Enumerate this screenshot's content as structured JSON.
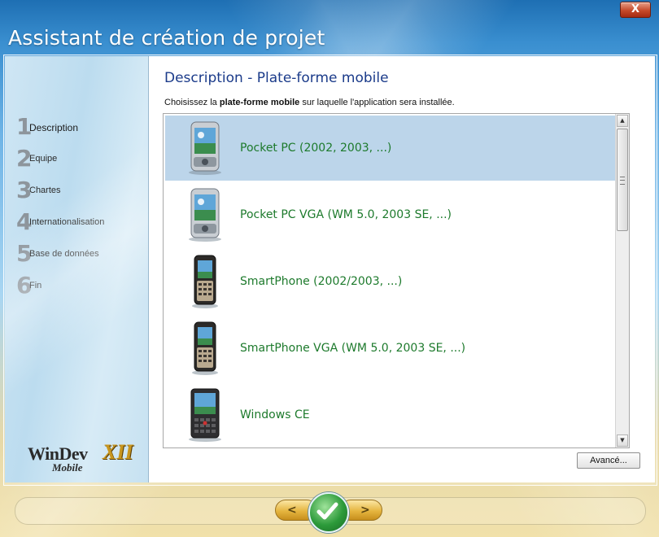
{
  "window": {
    "title": "Assistant de création de projet",
    "close_label": "X"
  },
  "sidebar": {
    "steps": [
      {
        "num": "1",
        "label": "Description",
        "active": true
      },
      {
        "num": "2",
        "label": "Equipe"
      },
      {
        "num": "3",
        "label": "Chartes"
      },
      {
        "num": "4",
        "label": "Internationalisation"
      },
      {
        "num": "5",
        "label": "Base de données"
      },
      {
        "num": "6",
        "label": "Fin"
      }
    ],
    "logo": {
      "main": "WinDev",
      "sub": "Mobile",
      "version": "XII"
    }
  },
  "main": {
    "heading": "Description - Plate-forme mobile",
    "instruction_prefix": "Choisissez la ",
    "instruction_bold": "plate-forme mobile",
    "instruction_suffix": " sur laquelle l'application sera installée.",
    "platforms": [
      {
        "label": "Pocket PC (2002, 2003, ...)",
        "icon": "pocketpc-icon",
        "selected": true
      },
      {
        "label": "Pocket PC VGA (WM 5.0, 2003 SE, ...)",
        "icon": "pocketpc-icon"
      },
      {
        "label": "SmartPhone (2002/2003, ...)",
        "icon": "smartphone-icon"
      },
      {
        "label": "SmartPhone VGA (WM 5.0, 2003 SE, ...)",
        "icon": "smartphone-icon"
      },
      {
        "label": "Windows CE",
        "icon": "windows-ce-device-icon"
      }
    ],
    "advanced_label": "Avancé..."
  },
  "nav": {
    "prev_label": "<",
    "next_label": ">",
    "ok_label": "✓"
  },
  "colors": {
    "accent_heading": "#1b3b8a",
    "platform_text": "#1d7a2c",
    "selection": "#bcd5ea"
  }
}
